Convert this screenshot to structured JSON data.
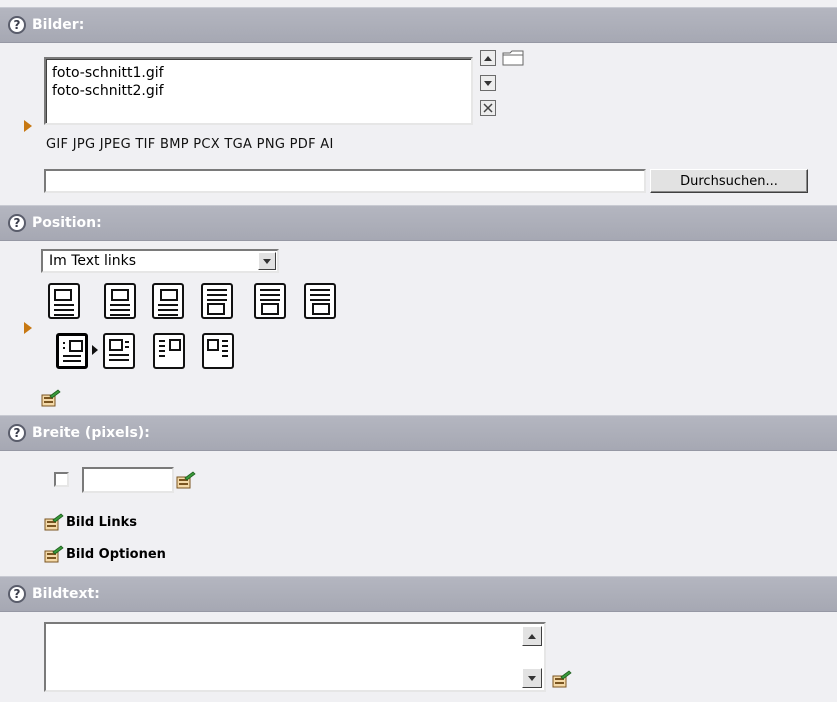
{
  "sections": {
    "bilder": {
      "title": "Bilder:"
    },
    "position": {
      "title": "Position:"
    },
    "breite": {
      "title": "Breite (pixels):"
    },
    "bildtext": {
      "title": "Bildtext:"
    }
  },
  "bilder": {
    "files": [
      "foto-schnitt1.gif",
      "foto-schnitt2.gif"
    ],
    "formats": "GIF JPG JPEG TIF BMP PCX TGA PNG PDF AI",
    "file_input_value": "",
    "browse_label": "Durchsuchen..."
  },
  "position": {
    "selected": "Im Text links"
  },
  "breite": {
    "value": ""
  },
  "links": {
    "bild_links": "Bild Links",
    "bild_optionen": "Bild Optionen"
  },
  "bildtext": {
    "value": ""
  },
  "icons": {
    "help": "?",
    "accent": "#c77812",
    "header_bg": "#a6a8b3"
  }
}
